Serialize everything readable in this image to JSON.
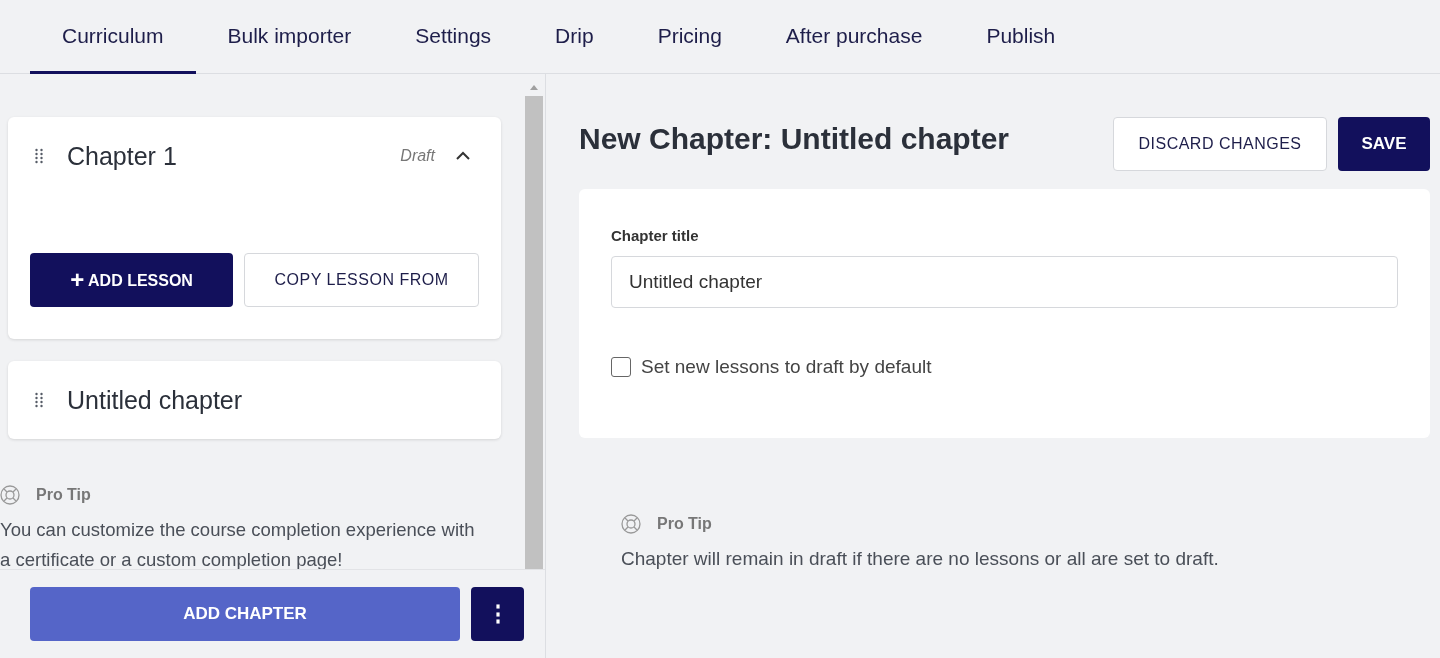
{
  "tabs": [
    {
      "label": "Curriculum",
      "selected": true
    },
    {
      "label": "Bulk importer",
      "selected": false
    },
    {
      "label": "Settings",
      "selected": false
    },
    {
      "label": "Drip",
      "selected": false
    },
    {
      "label": "Pricing",
      "selected": false
    },
    {
      "label": "After purchase",
      "selected": false
    },
    {
      "label": "Publish",
      "selected": false
    }
  ],
  "chapters": [
    {
      "title": "Chapter 1",
      "status": "Draft",
      "expanded": true,
      "actions": [
        "+",
        "ADD LESSON",
        "COPY LESSON FROM"
      ]
    },
    {
      "title": "Untitled chapter",
      "expanded": false
    }
  ],
  "sidebar_tip": {
    "heading": "Pro Tip",
    "text": "You can customize the course completion experience with a certificate or a custom completion page!"
  },
  "sidebar_footer": {
    "add_button": "ADD CHAPTER",
    "more_button": "⋮"
  },
  "editor": {
    "title": "New Chapter: Untitled chapter",
    "discard_button": "DISCARD CHANGES",
    "save_button": "SAVE",
    "field_label": "Chapter title",
    "field_value": "Untitled chapter",
    "checkbox": {
      "label": "Set new lessons to draft by default",
      "checked": false
    }
  },
  "editor_tip": {
    "heading": "Pro Tip",
    "text": "Chapter will remain in draft if there are no lessons or all are set to draft."
  }
}
